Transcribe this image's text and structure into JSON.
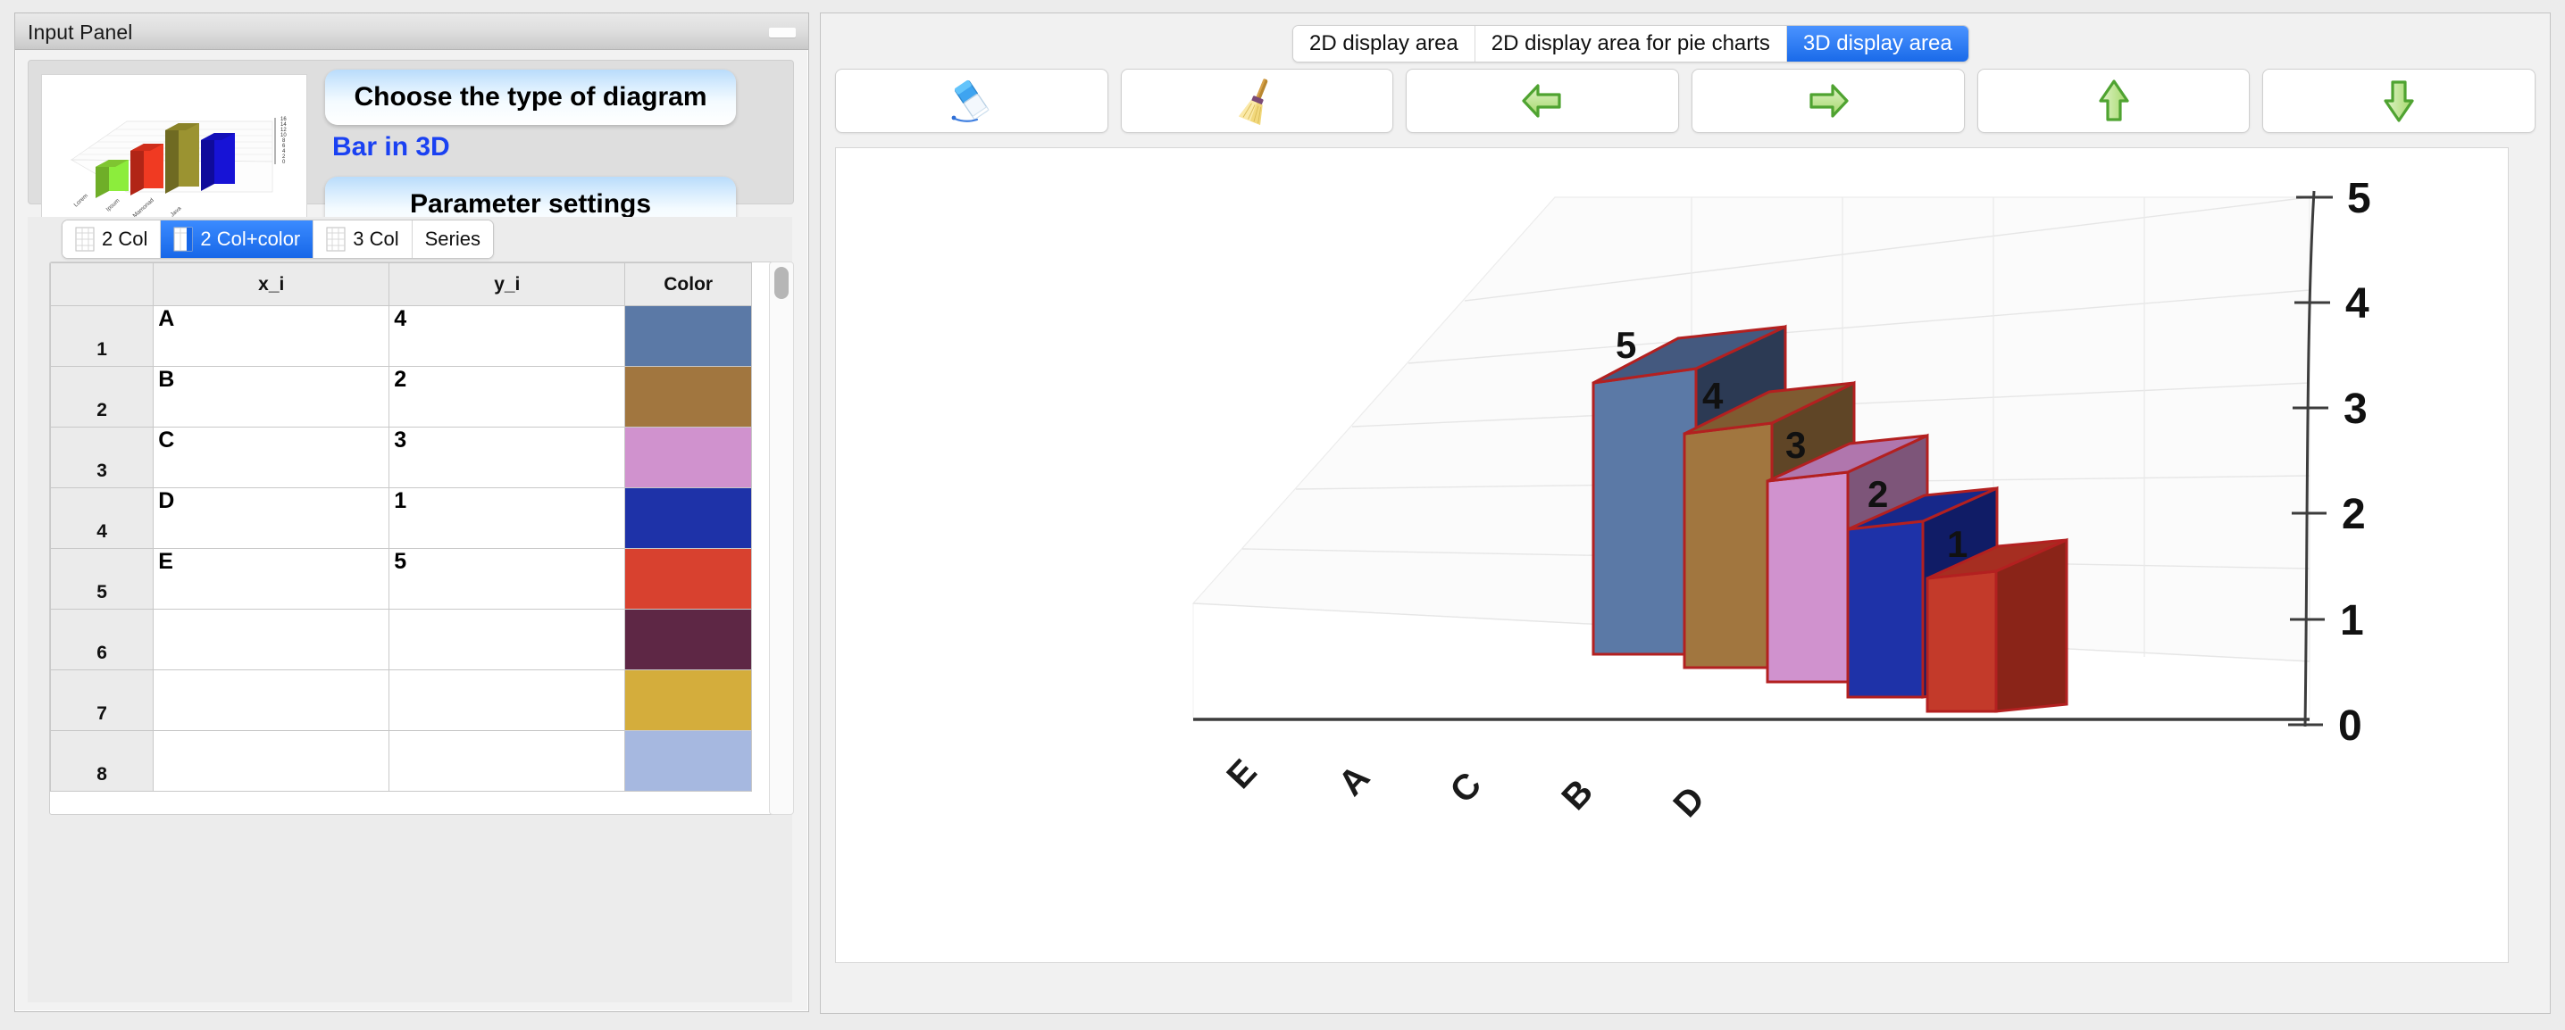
{
  "input_panel": {
    "title": "Input Panel",
    "minimize_label": "",
    "choose_type_label": "Choose the type of diagram",
    "diagram_type_label": "Bar in 3D",
    "parameter_settings_label": "Parameter settings",
    "preview": {
      "categories": [
        "Lorem",
        "Ipsum",
        "Mamonad",
        "Java"
      ],
      "values": [
        4,
        9,
        15,
        11
      ],
      "colors": [
        "#76bb2e",
        "#e2311f",
        "#8e8631",
        "#1713d6"
      ],
      "axis_ticks": [
        "16",
        "14",
        "12",
        "10",
        "8",
        "6",
        "4",
        "2",
        "0"
      ]
    }
  },
  "table_tabs": [
    {
      "label": "2 Col",
      "active": false
    },
    {
      "label": "2 Col+color",
      "active": true
    },
    {
      "label": "3 Col",
      "active": false
    },
    {
      "label": "Series",
      "active": false
    }
  ],
  "grid": {
    "headers": [
      "",
      "x_i",
      "y_i",
      "Color"
    ],
    "rows": [
      {
        "index": "1",
        "x": "A",
        "y": "4",
        "color": "#5b79a6"
      },
      {
        "index": "2",
        "x": "B",
        "y": "2",
        "color": "#a1763f"
      },
      {
        "index": "3",
        "x": "C",
        "y": "3",
        "color": "#d092ce"
      },
      {
        "index": "4",
        "x": "D",
        "y": "1",
        "color": "#1e32a8"
      },
      {
        "index": "5",
        "x": "E",
        "y": "5",
        "color": "#d8412f"
      },
      {
        "index": "6",
        "x": "",
        "y": "",
        "color": "#5e2745"
      },
      {
        "index": "7",
        "x": "",
        "y": "",
        "color": "#d4ad3c"
      },
      {
        "index": "8",
        "x": "",
        "y": "",
        "color": "#a6b8e0"
      }
    ]
  },
  "display_tabs": [
    {
      "label": "2D display area",
      "active": false
    },
    {
      "label": "2D display area for pie charts",
      "active": false
    },
    {
      "label": "3D display area",
      "active": true
    }
  ],
  "toolbar": [
    {
      "name": "eraser-icon",
      "tooltip": "Eraser"
    },
    {
      "name": "broom-icon",
      "tooltip": "Clear"
    },
    {
      "name": "arrow-left-icon",
      "tooltip": "Rotate left"
    },
    {
      "name": "arrow-right-icon",
      "tooltip": "Rotate right"
    },
    {
      "name": "arrow-up-icon",
      "tooltip": "Rotate up"
    },
    {
      "name": "arrow-down-icon",
      "tooltip": "Rotate down"
    }
  ],
  "colors": {
    "accent": "#1767e8",
    "type_label": "#1a41f2",
    "bar_outline": "#b32020",
    "panel_bg": "#ececec"
  },
  "chart_data": {
    "type": "bar",
    "render": "3d",
    "title": "",
    "xlabel": "",
    "ylabel": "",
    "categories": [
      "E",
      "A",
      "C",
      "B",
      "D"
    ],
    "values": [
      5,
      4,
      3,
      2,
      1
    ],
    "bar_labels": [
      "5",
      "4",
      "3",
      "2",
      "1"
    ],
    "colors": [
      "#5b79a6",
      "#a1763f",
      "#d092ce",
      "#1e32a8",
      "#c33a2a"
    ],
    "side_colors": [
      "#2c3a54",
      "#5f4526",
      "#7d5579",
      "#101c66",
      "#8a2418"
    ],
    "top_colors": [
      "#44597f",
      "#7f5b31",
      "#b076ad",
      "#17288a",
      "#a62e21"
    ],
    "outline": "#b32020",
    "ylim": [
      0,
      5
    ],
    "yticks": [
      0,
      1,
      2,
      3,
      4,
      5
    ],
    "ytick_labels": [
      "0",
      "1",
      "2",
      "3",
      "4",
      "5"
    ],
    "xtick_labels": [
      "E",
      "A",
      "C",
      "B",
      "D"
    ],
    "grid": true,
    "legend": "none",
    "axis_position": "right"
  }
}
